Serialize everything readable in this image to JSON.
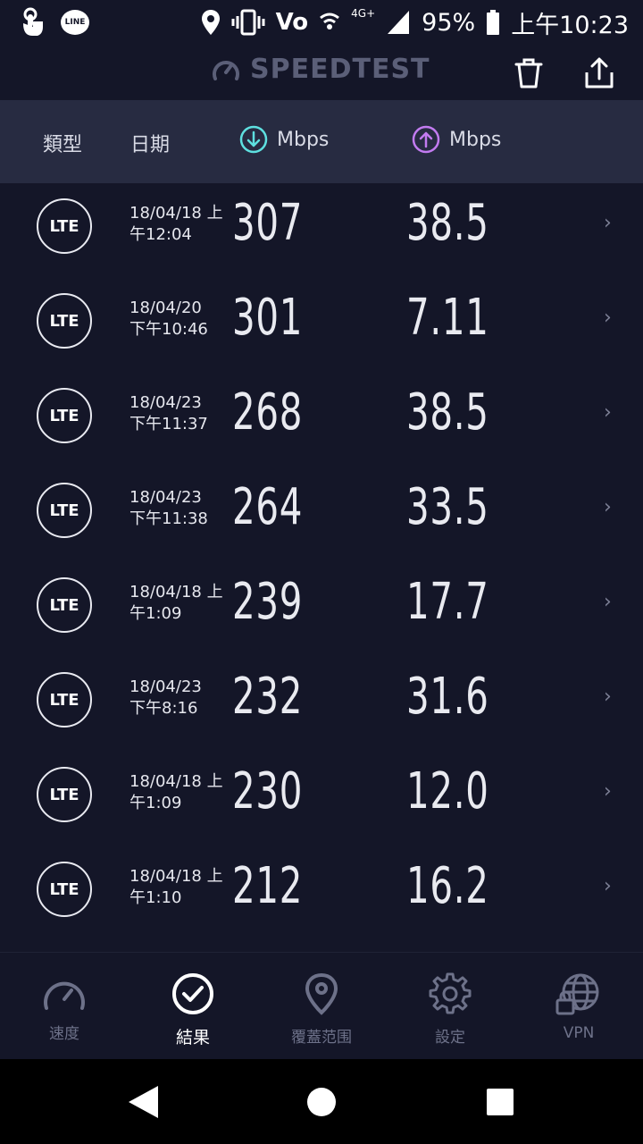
{
  "status_bar": {
    "line_badge": "LINE",
    "volte": "Vo",
    "network": "4G+",
    "battery": "95%",
    "time": "上午10:23"
  },
  "header": {
    "brand": "SPEEDTEST"
  },
  "columns": {
    "type": "類型",
    "date": "日期",
    "download_unit": "Mbps",
    "upload_unit": "Mbps"
  },
  "results": [
    {
      "type": "LTE",
      "date_line1": "18/04/18 上",
      "date_line2": "午12:04",
      "download": "307",
      "upload": "38.5"
    },
    {
      "type": "LTE",
      "date_line1": "18/04/20",
      "date_line2": "下午10:46",
      "download": "301",
      "upload": "7.11"
    },
    {
      "type": "LTE",
      "date_line1": "18/04/23",
      "date_line2": "下午11:37",
      "download": "268",
      "upload": "38.5"
    },
    {
      "type": "LTE",
      "date_line1": "18/04/23",
      "date_line2": "下午11:38",
      "download": "264",
      "upload": "33.5"
    },
    {
      "type": "LTE",
      "date_line1": "18/04/18 上",
      "date_line2": "午1:09",
      "download": "239",
      "upload": "17.7"
    },
    {
      "type": "LTE",
      "date_line1": "18/04/23",
      "date_line2": "下午8:16",
      "download": "232",
      "upload": "31.6"
    },
    {
      "type": "LTE",
      "date_line1": "18/04/18 上",
      "date_line2": "午1:09",
      "download": "230",
      "upload": "12.0"
    },
    {
      "type": "LTE",
      "date_line1": "18/04/18 上",
      "date_line2": "午1:10",
      "download": "212",
      "upload": "16.2"
    }
  ],
  "nav": {
    "speed": "速度",
    "results": "結果",
    "coverage": "覆蓋范围",
    "settings": "設定",
    "vpn": "VPN"
  },
  "colors": {
    "background": "#141628",
    "header_band": "#272b41",
    "download_accent": "#5ee0e0",
    "upload_accent": "#c27bf0"
  }
}
